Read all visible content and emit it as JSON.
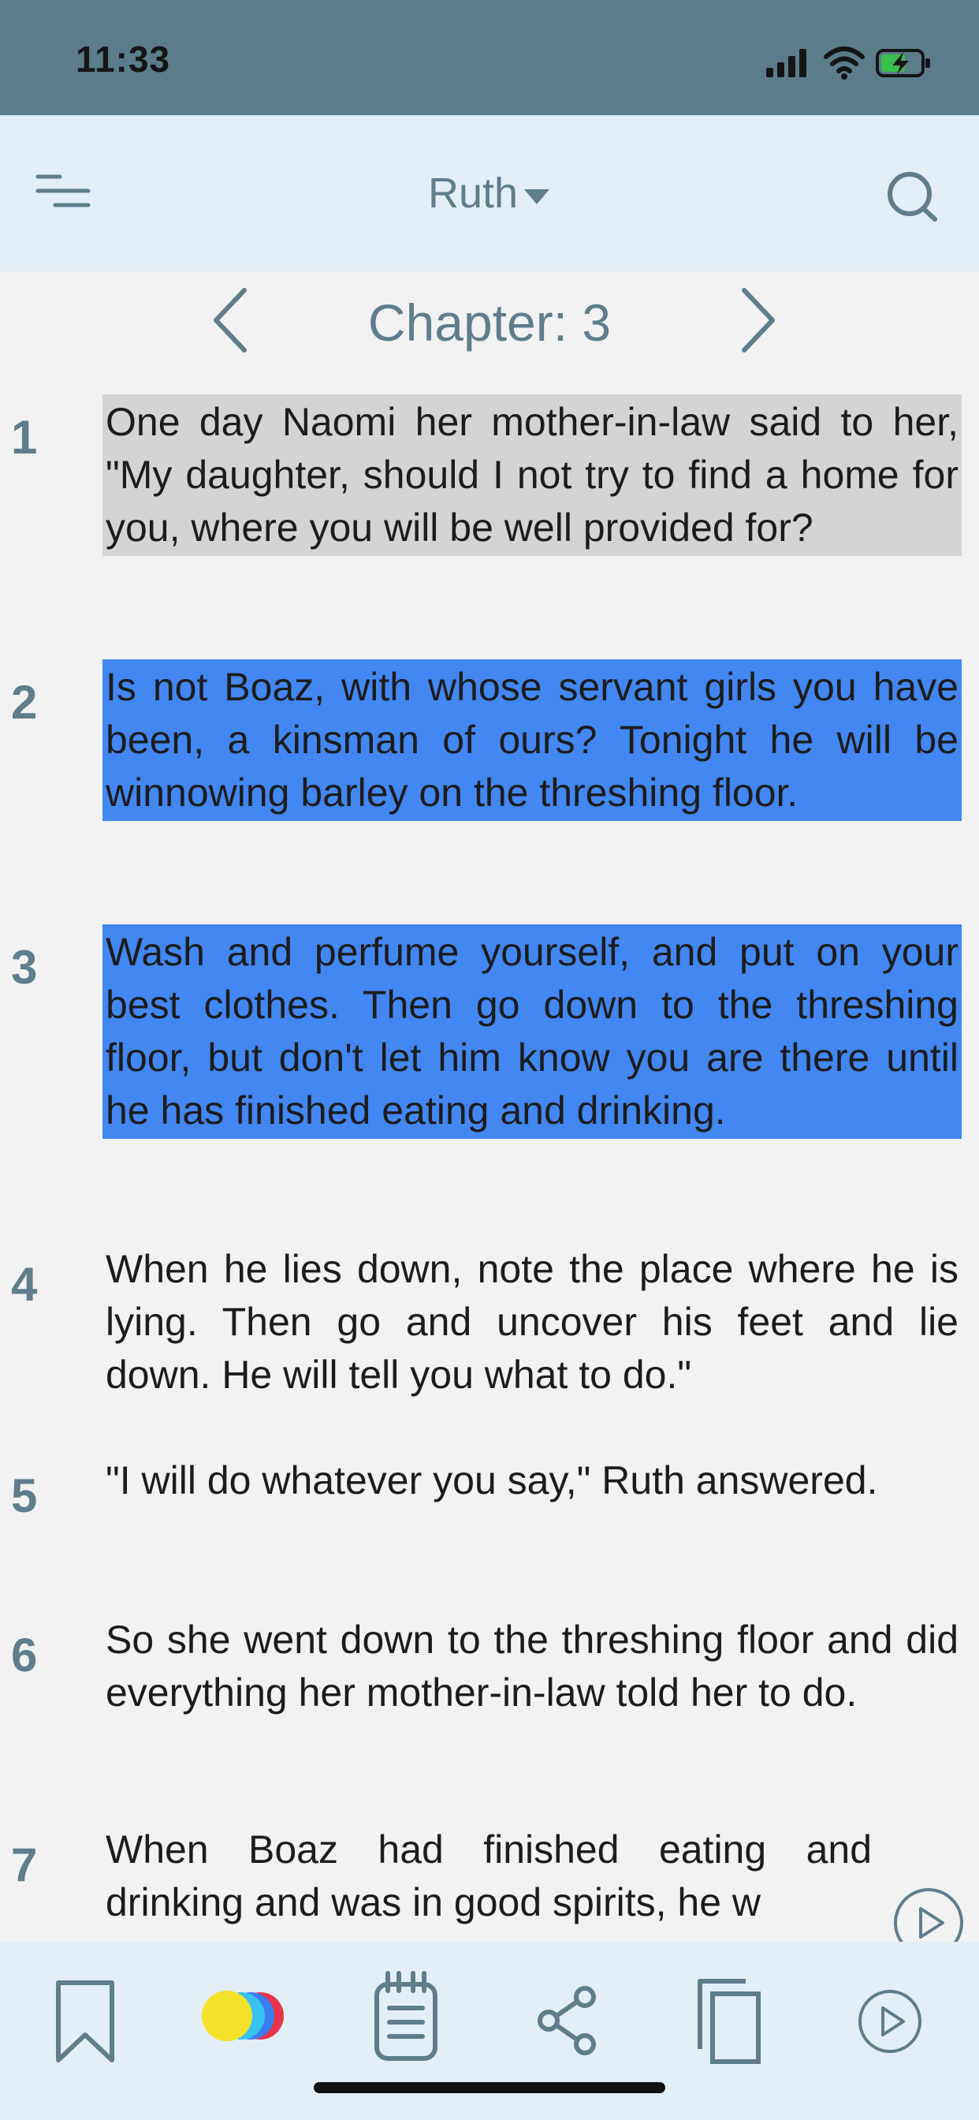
{
  "status_bar": {
    "time": "11:33",
    "icons": [
      "cellular-signal-icon",
      "wifi-icon",
      "battery-charging-icon"
    ]
  },
  "header": {
    "menu_icon": "menu-lines-icon",
    "book_title": "Ruth",
    "book_caret_icon": "caret-down-icon",
    "search_icon": "search-icon"
  },
  "chapter_nav": {
    "label": "Chapter: 3",
    "prev_icon": "chevron-left-icon",
    "next_icon": "chevron-right-icon"
  },
  "verses": [
    {
      "number": "1",
      "text": "One day Naomi her mother-in-law said to her, \"My daughter, should I not try to find a home for you, where you will be well provided for?",
      "highlight": "grey"
    },
    {
      "number": "2",
      "text": "Is not Boaz, with whose servant girls you have been, a kinsman of ours? Tonight he will be winnowing barley on the threshing floor.",
      "highlight": "blue"
    },
    {
      "number": "3",
      "text": "Wash and perfume yourself, and put on your best clothes. Then go down to the threshing floor, but don't let him know you are there until he has finished eating and drinking.",
      "highlight": "blue"
    },
    {
      "number": "4",
      "text": "When he lies down, note the place where he is lying. Then go and uncover his feet and lie down. He will tell you what to do.\"",
      "highlight": "none"
    },
    {
      "number": "5",
      "text": "\"I will do whatever you say,\" Ruth answered.",
      "highlight": "none"
    },
    {
      "number": "6",
      "text": "So she went down to the threshing floor and did everything her mother-in-law told her to do.",
      "highlight": "none"
    },
    {
      "number": "7",
      "text": "When Boaz had finished eating and drinking and was in good spirits, he w",
      "highlight": "none"
    }
  ],
  "highlight_colors": {
    "grey": "#d4d4d4",
    "blue": "#4287f2"
  },
  "accent_color": "#5f7d8a",
  "toolbar": {
    "icons": [
      "bookmark-icon",
      "highlight-colors-icon",
      "notes-icon",
      "share-icon",
      "copy-icon",
      "play-icon"
    ],
    "color_dots": [
      "#f4e12a",
      "#38c2f0",
      "#3a7df2",
      "#e8344a"
    ]
  },
  "floating_audio_icon": "play-circle-icon"
}
